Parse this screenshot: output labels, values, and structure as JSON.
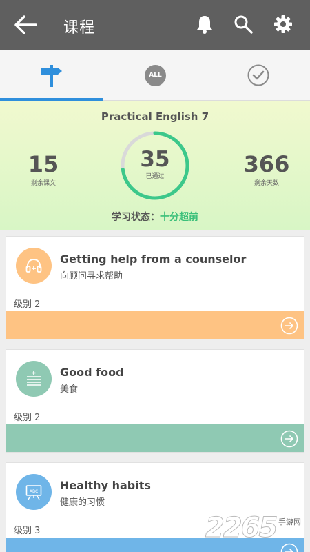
{
  "appbar": {
    "title": "课程"
  },
  "tabs": [
    {
      "name": "signpost",
      "active": true
    },
    {
      "name": "all",
      "label": "ALL",
      "active": false
    },
    {
      "name": "done",
      "active": false
    }
  ],
  "summary": {
    "book": "Practical English 7",
    "remaining_lessons": {
      "value": "15",
      "label": "剩余课文"
    },
    "passed": {
      "value": "35",
      "label": "已通过",
      "progress_fraction": 0.73
    },
    "remaining_days": {
      "value": "366",
      "label": "剩余天数"
    },
    "status_label": "学习状态：",
    "status_value": "十分超前"
  },
  "lessons": [
    {
      "title": "Getting help from a counselor",
      "subtitle": "向顾问寻求帮助",
      "level": "级别 2",
      "color": "#fec383",
      "icon": "headphones-icon"
    },
    {
      "title": "Good food",
      "subtitle": "美食",
      "level": "级别 2",
      "color": "#8fc9b3",
      "icon": "menu-list-icon"
    },
    {
      "title": "Healthy habits",
      "subtitle": "健康的习惯",
      "level": "级别 3",
      "color": "#6fb5e8",
      "icon": "abc-board-icon"
    }
  ],
  "watermark": {
    "digits": "2265",
    "text": "手游网"
  },
  "colors": {
    "appbar": "#5f5f5f",
    "accent": "#2f8fdc",
    "ring": "#3cc88a",
    "status": "#3cc07a"
  }
}
